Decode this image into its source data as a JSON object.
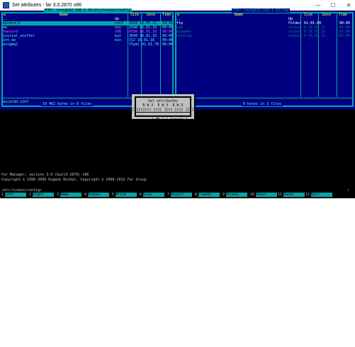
{
  "window": {
    "title": "Set attributes - far 3.0.2870 x86",
    "minimize": "—",
    "maximize": "☐",
    "close": "✕"
  },
  "left_panel": {
    "title": "FTP: root@192.168.1.65/etc/tuxbox/config",
    "col_name": "Name",
    "col_size": "Size",
    "col_date": "Date",
    "col_time": "Time",
    "col_w": "w",
    "rows": [
      {
        "name": "..",
        "size": "Up",
        "date": "",
        "time": "",
        "cls": "c-white"
      },
      {
        "name": "wicard.d",
        "size": "conf",
        "date": "3143 16.09.21",
        "time": "19:41",
        "cls": "cursor"
      },
      {
        "name": "ee",
        "size": "bin",
        "date": "2048 16.01.16",
        "time": "00:00",
        "cls": "c-cyan"
      },
      {
        "name": "fwncard",
        "size": "x86",
        "date": "6556 16.01.16",
        "time": "00:00",
        "cls": "c-magenta"
      },
      {
        "name": "initial_sniffer",
        "size": "bin",
        "date": "3694 16.01.16",
        "time": "00:00",
        "cls": "c-cyan"
      },
      {
        "name": "int_ee",
        "size": "bin",
        "date": "512 16.01.16",
        "time": "00:00",
        "cls": "c-cyan"
      },
      {
        "name": "enigma2",
        "size": "",
        "date": "75yml 01.01.70",
        "time": "00:00",
        "cls": "c-cyan"
      }
    ],
    "status": "wicardd.conf",
    "summary": "19 462 bytes in 6 files"
  },
  "right_panel": {
    "title": "FTP: root@192.168.1.65/tmp",
    "col_name": "Name",
    "col_size": "Size",
    "col_date": "Date",
    "col_time": "Time",
    "col_w": "w",
    "rows": [
      {
        "name": "..",
        "size": "Up",
        "date": "",
        "time": "",
        "cls": "c-white"
      },
      {
        "name": "ftp",
        "size": "Folder",
        "date": "01.01.00",
        "time": "00:00",
        "cls": "c-white"
      },
      {
        "name": "cmd",
        "size": "socket",
        "date": "0 16.09.21",
        "time": "05:46",
        "cls": "c-dim"
      },
      {
        "name": "wiwemen",
        "size": "socket",
        "date": "0 16.09.21",
        "time": "05:46",
        "cls": "c-dim"
      },
      {
        "name": "hotplug",
        "size": "socket",
        "date": "0 16.09.21",
        "time": "05:46",
        "cls": "c-dim"
      }
    ],
    "status": "",
    "summary": "0 bytes in 3 files"
  },
  "dialog": {
    "title": "Set attributes",
    "header": "R W X  R W X  R W X",
    "checks": "[x][x][x] [x][ ][x] [x][ ][x]",
    "ok": "{ OK }",
    "cancel": "[ Cancel ]"
  },
  "console": {
    "info1": "Far Manager, version 3.0 (build 2870) x86",
    "info2": "Copyright © 1996-2000 Eugene Roshal, Copyright © 2000-2012 Far Group",
    "prompt": "/etc/tuxbox/config>",
    "prompt_marker": "↑"
  },
  "keybar": [
    {
      "num": "1",
      "label": "Left"
    },
    {
      "num": "2",
      "label": "Right"
    },
    {
      "num": "3",
      "label": "Name"
    },
    {
      "num": "4",
      "label": "Extens"
    },
    {
      "num": "5",
      "label": "Write"
    },
    {
      "num": "6",
      "label": "Size"
    },
    {
      "num": "7",
      "label": "Unsort"
    },
    {
      "num": "8",
      "label": "Creatn"
    },
    {
      "num": "9",
      "label": "Access"
    },
    {
      "num": "10",
      "label": "Descr"
    },
    {
      "num": "11",
      "label": "Owner"
    },
    {
      "num": "12",
      "label": "Sort"
    }
  ],
  "colors": {
    "panel_bg": "#000080",
    "frame": "#00a8a8",
    "header_text": "#ffff55",
    "file_text": "#55ffff",
    "dialog_bg": "#c0c0c0"
  }
}
